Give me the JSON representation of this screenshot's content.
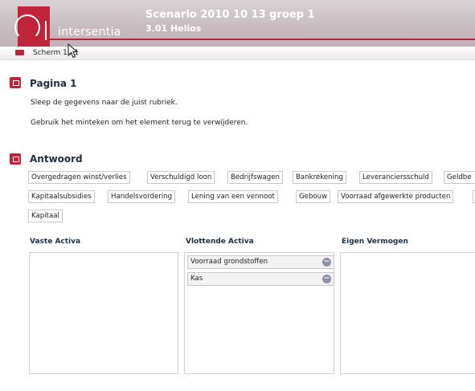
{
  "header": {
    "brand": "intersentia",
    "title": "Scenario 2010 10 13 groep 1",
    "subtitle": "3.01 Helios"
  },
  "nav": {
    "screen_label": "Scherm 1 / 1"
  },
  "page_section": {
    "title": "Pagina 1",
    "instruction_1": "Sleep de gegevens naar de juist rubriek.",
    "instruction_2": "Gebruik het minteken om het element terug te verwijderen."
  },
  "answer_section": {
    "title": "Antwoord",
    "items": [
      "Overgedragen winst/verlies",
      "Verschuldigd loon",
      "Bedrijfswagen",
      "Bankrekening",
      "Leveranciersschuld",
      "Geldbe",
      "Kapitaalsubsidies",
      "Handelsvordering",
      "Lening van een vennoot",
      "Gebouw",
      "Voorraad afgewerkte producten",
      "Kapitaal"
    ]
  },
  "columns": [
    {
      "title": "Vaste Activa",
      "items": []
    },
    {
      "title": "Vlottende Activa",
      "items": [
        "Voorraad grondstoffen",
        "Kas"
      ]
    },
    {
      "title": "Eigen Vermogen",
      "items": []
    }
  ],
  "colors": {
    "accent_red": "#c0243a",
    "header_bg": "#c7bbc0",
    "title_navy": "#1d2e44",
    "remove_icon": "#8a93a6"
  },
  "icons": {
    "section": "section-flag-icon",
    "remove": "minus-circle-icon",
    "cursor": "mouse-pointer-icon"
  }
}
